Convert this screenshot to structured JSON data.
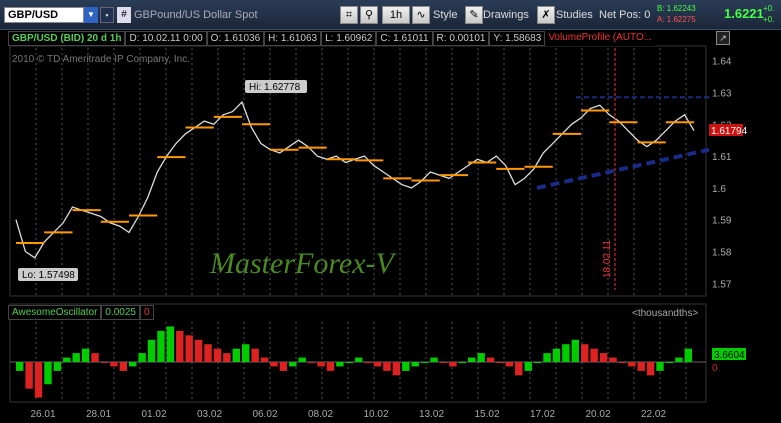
{
  "toolbar": {
    "symbol": "GBP/USD",
    "description": "GBPound/US Dollar Spot",
    "timeframe": "1h",
    "style_label": "Style",
    "drawings_label": "Drawings",
    "studies_label": "Studies",
    "net_pos_label": "Net Pos: 0",
    "bid": "B: 1.62243",
    "ask": "A: 1.62275",
    "last": "1.6221",
    "change": "+0.",
    "change2": "+0."
  },
  "header": {
    "symbol": "GBP/USD (BID) 20 d 1h",
    "date": "D: 10.02.11 0:00",
    "open": "O: 1.61036",
    "high": "H: 1.61063",
    "low": "L: 1.60962",
    "close": "C: 1.61011",
    "range": "R: 0.00101",
    "y": "Y: 1.58683",
    "volume_profile": "VolumeProfile (AUTO..."
  },
  "copyright": "2010 © TD Ameritrade IP Company, Inc.",
  "watermark": "MasterForex-V",
  "annotations": {
    "hi": "Hi: 1.62778",
    "lo": "Lo: 1.57498",
    "vline_date": "18.02.11",
    "current_price": "1.61794"
  },
  "oscillator": {
    "name": "AwesomeOscillator",
    "value": "0.0025",
    "zero": "0",
    "units": "<thousandths>",
    "current": "3.6604",
    "current_color": "#0c0"
  },
  "chart_data": {
    "type": "line",
    "price_axis": {
      "ylim": [
        1.566,
        1.644
      ],
      "ticks": [
        "1.64",
        "1.63",
        "1.62",
        "1.61",
        "1.6",
        "1.59",
        "1.58",
        "1.57"
      ],
      "tick_values": [
        1.64,
        1.63,
        1.62,
        1.61,
        1.6,
        1.59,
        1.58,
        1.57
      ]
    },
    "x_labels": [
      "26.01",
      "28.01",
      "01.02",
      "03.02",
      "06.02",
      "08.02",
      "10.02",
      "13.02",
      "15.02",
      "17.02",
      "20.02",
      "22.02"
    ],
    "price_series": [
      1.59,
      1.58,
      1.578,
      1.583,
      1.586,
      1.589,
      1.594,
      1.593,
      1.592,
      1.591,
      1.589,
      1.588,
      1.586,
      1.591,
      1.597,
      1.605,
      1.61,
      1.614,
      1.617,
      1.619,
      1.621,
      1.62,
      1.623,
      1.624,
      1.627,
      1.619,
      1.614,
      1.612,
      1.611,
      1.613,
      1.615,
      1.613,
      1.61,
      1.609,
      1.61,
      1.608,
      1.609,
      1.61,
      1.607,
      1.605,
      1.603,
      1.601,
      1.6,
      1.602,
      1.605,
      1.604,
      1.603,
      1.605,
      1.607,
      1.609,
      1.608,
      1.61,
      1.607,
      1.601,
      1.603,
      1.606,
      1.611,
      1.614,
      1.617,
      1.62,
      1.622,
      1.625,
      1.626,
      1.623,
      1.621,
      1.618,
      1.615,
      1.613,
      1.615,
      1.618,
      1.621,
      1.623,
      1.618
    ],
    "ao_series": [
      -2,
      -6,
      -8,
      -5,
      -2,
      1,
      2,
      3,
      2,
      0,
      -1,
      -2,
      -1,
      2,
      5,
      7,
      8,
      7,
      6,
      5,
      4,
      3,
      2,
      3,
      4,
      3,
      1,
      -1,
      -2,
      -1,
      1,
      0,
      -1,
      -2,
      -1,
      0,
      1,
      0,
      -1,
      -2,
      -3,
      -2,
      -1,
      0,
      1,
      0,
      -1,
      0,
      1,
      2,
      1,
      0,
      -1,
      -3,
      -2,
      0,
      2,
      3,
      4,
      5,
      4,
      3,
      2,
      1,
      0,
      -1,
      -2,
      -3,
      -2,
      0,
      1,
      3
    ],
    "ao_ylim": [
      -9,
      9
    ]
  }
}
